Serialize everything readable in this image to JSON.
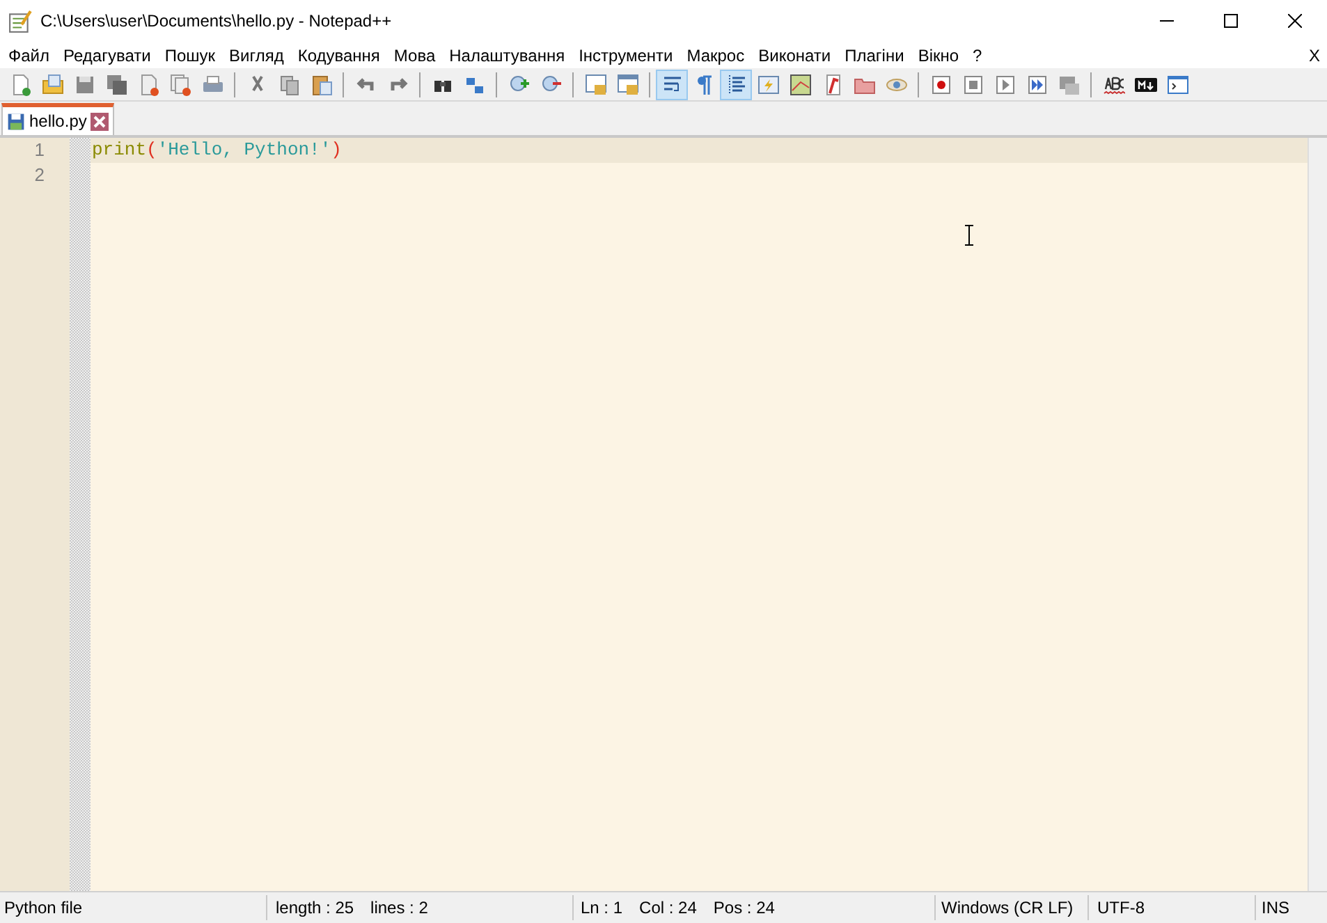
{
  "window": {
    "title": "C:\\Users\\user\\Documents\\hello.py - Notepad++"
  },
  "menu": [
    "Файл",
    "Редагувати",
    "Пошук",
    "Вигляд",
    "Кодування",
    "Мова",
    "Налаштування",
    "Інструменти",
    "Макрос",
    "Виконати",
    "Плагіни",
    "Вікно",
    "?"
  ],
  "menu_close": "X",
  "toolbar": [
    [
      {
        "selected": false
      },
      {
        "selected": false
      },
      {
        "selected": false
      },
      {
        "selected": false
      },
      {
        "selected": false
      },
      {
        "selected": false
      },
      {
        "selected": false
      }
    ],
    [
      {
        "selected": false
      },
      {
        "selected": false
      },
      {
        "selected": false
      }
    ],
    [
      {
        "selected": false
      },
      {
        "selected": false
      }
    ],
    [
      {
        "selected": false
      },
      {
        "selected": false
      }
    ],
    [
      {
        "selected": false
      },
      {
        "selected": false
      }
    ],
    [
      {
        "selected": false
      },
      {
        "selected": false
      }
    ],
    [
      {
        "selected": true
      },
      {
        "selected": false
      },
      {
        "selected": true
      },
      {
        "selected": false
      },
      {
        "selected": false
      },
      {
        "selected": false
      },
      {
        "selected": false
      },
      {
        "selected": false
      }
    ],
    [
      {
        "selected": false
      },
      {
        "selected": false
      },
      {
        "selected": false
      },
      {
        "selected": false
      },
      {
        "selected": false
      }
    ],
    [
      {
        "selected": false
      },
      {
        "selected": false
      },
      {
        "selected": false
      }
    ]
  ],
  "tabs": [
    {
      "label": "hello.py",
      "selected": true
    }
  ],
  "editor": {
    "lines": [
      {
        "number": "1",
        "current": true,
        "tokens": [
          {
            "kind": "function",
            "text": "print"
          },
          {
            "kind": "paren",
            "text": "("
          },
          {
            "kind": "string",
            "text": "'Hello, Python!'"
          },
          {
            "kind": "paren",
            "text": ")"
          }
        ]
      },
      {
        "number": "2",
        "current": false
      }
    ]
  },
  "status_bar": {
    "file_type": "Python file",
    "length": "length : 25",
    "lines": "lines : 2",
    "ln": "Ln : 1",
    "col": "Col : 24",
    "pos": "Pos : 24",
    "eol": "Windows (CR LF)",
    "encoding": "UTF-8",
    "mode": "INS"
  }
}
